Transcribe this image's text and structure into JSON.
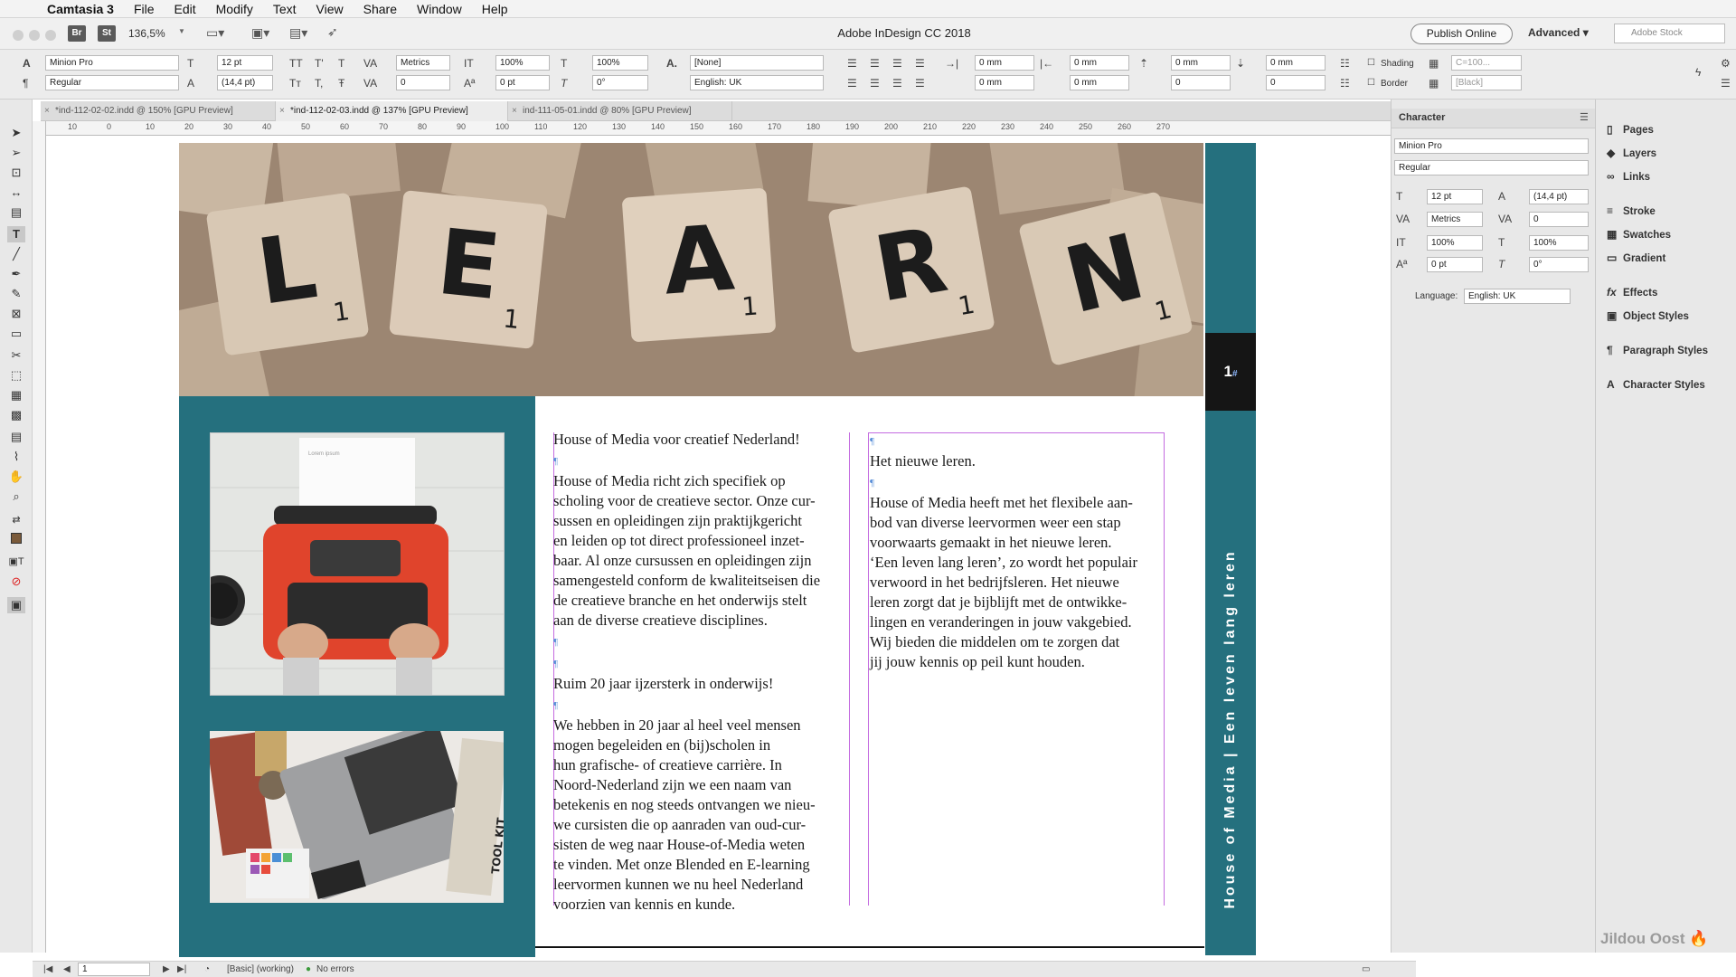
{
  "menubar": {
    "app": "Camtasia 3",
    "items": [
      "File",
      "Edit",
      "Modify",
      "Text",
      "View",
      "Share",
      "Window",
      "Help"
    ]
  },
  "appbar": {
    "zoom": "136,5%",
    "title": "Adobe InDesign CC 2018",
    "publish": "Publish Online",
    "workspace": "Advanced",
    "stock_placeholder": "Adobe Stock",
    "br": "Br",
    "st": "St"
  },
  "control": {
    "font": "Minion Pro",
    "style": "Regular",
    "size": "12 pt",
    "leading": "(14,4 pt)",
    "kerning": "Metrics",
    "tracking": "0",
    "vscale": "100%",
    "hscale": "100%",
    "baseline": "0 pt",
    "skew": "0°",
    "charstyle": "[None]",
    "language": "English: UK",
    "indent_left": "0 mm",
    "indent_right": "0 mm",
    "first_line": "0 mm",
    "last_line": "0 mm",
    "space_before": "0 mm",
    "space_after": "0 mm",
    "drop_lines": "0",
    "drop_chars": "0",
    "shading_label": "Shading",
    "border_label": "Border",
    "swatch1": "C=100...",
    "swatch2": "[Black]"
  },
  "tabs": [
    {
      "label": "*ind-112-02-02.indd @ 150% [GPU Preview]"
    },
    {
      "label": "*ind-112-02-03.indd @ 137% [GPU Preview]"
    },
    {
      "label": "ind-111-05-01.indd @ 80% [GPU Preview]"
    }
  ],
  "ruler": {
    "marks": [
      "10",
      "0",
      "10",
      "20",
      "30",
      "40",
      "50",
      "60",
      "70",
      "80",
      "90",
      "100",
      "110",
      "120",
      "130",
      "140",
      "150",
      "160",
      "170",
      "180",
      "190",
      "200",
      "210",
      "220",
      "230",
      "240",
      "250",
      "260",
      "270"
    ]
  },
  "document": {
    "photo_letters": [
      "L",
      "E",
      "A",
      "R",
      "N"
    ],
    "photo_sub": "1",
    "page_number": "1",
    "page_marker": "#",
    "vertical_text": "House of Media | Een leven lang leren",
    "col1": [
      "House of Media voor creatief Nederland!",
      "",
      "House of Media richt zich specifiek op",
      "scholing voor de creatieve sector. Onze cur-",
      "sussen en opleidingen zijn praktijkgericht",
      "en leiden op tot direct professioneel inzet-",
      "baar. Al onze cursussen en opleidingen zijn",
      "samengesteld conform de kwaliteitseisen die",
      "de creatieve branche en het onderwijs stelt",
      "aan de diverse creatieve disciplines.",
      "",
      "",
      "Ruim 20 jaar ijzersterk in onderwijs!",
      "",
      "We hebben in 20 jaar al heel veel mensen",
      "mogen begeleiden en (bij)scholen in",
      "hun grafische- of creatieve carrière. In",
      "Noord-Nederland zijn we een naam van",
      "betekenis en nog steeds ontvangen we nieu-",
      "we cursisten die op aanraden van oud-cur-",
      "sisten de weg naar House-of-Media weten",
      "te vinden. Met onze Blended en E-learning",
      "leervormen kunnen we nu heel Nederland",
      "voorzien van kennis en kunde."
    ],
    "col2": [
      "",
      "Het nieuwe leren.",
      "",
      "House of Media heeft met het flexibele aan-",
      "bod van diverse leervormen weer een stap",
      "voorwaarts gemaakt in het nieuwe leren.",
      "‘Een leven lang leren’, zo wordt het populair",
      "verwoord in het bedrijfsleren. Het nieuwe",
      "leren zorgt dat je bijblijft met de ontwikke-",
      "lingen en veranderingen in jouw vakgebied.",
      "Wij bieden die middelen om te zorgen dat",
      "jij jouw kennis op peil kunt houden."
    ],
    "typewriter_paper": "Lorem ipsum",
    "notebook_text": "TOOL KIT"
  },
  "character_panel": {
    "title": "Character",
    "font": "Minion Pro",
    "style": "Regular",
    "size": "12 pt",
    "leading": "(14,4 pt)",
    "kerning": "Metrics",
    "tracking": "0",
    "vscale": "100%",
    "hscale": "100%",
    "baseline": "0 pt",
    "skew": "0°",
    "language_label": "Language:",
    "language": "English: UK"
  },
  "side_panels": [
    "Pages",
    "Layers",
    "Links",
    "Stroke",
    "Swatches",
    "Gradient",
    "Effects",
    "Object Styles",
    "Paragraph Styles",
    "Character Styles"
  ],
  "status": {
    "page": "1",
    "style": "[Basic] (working)",
    "errors": "No errors"
  },
  "watermark": "Jildou Oost"
}
